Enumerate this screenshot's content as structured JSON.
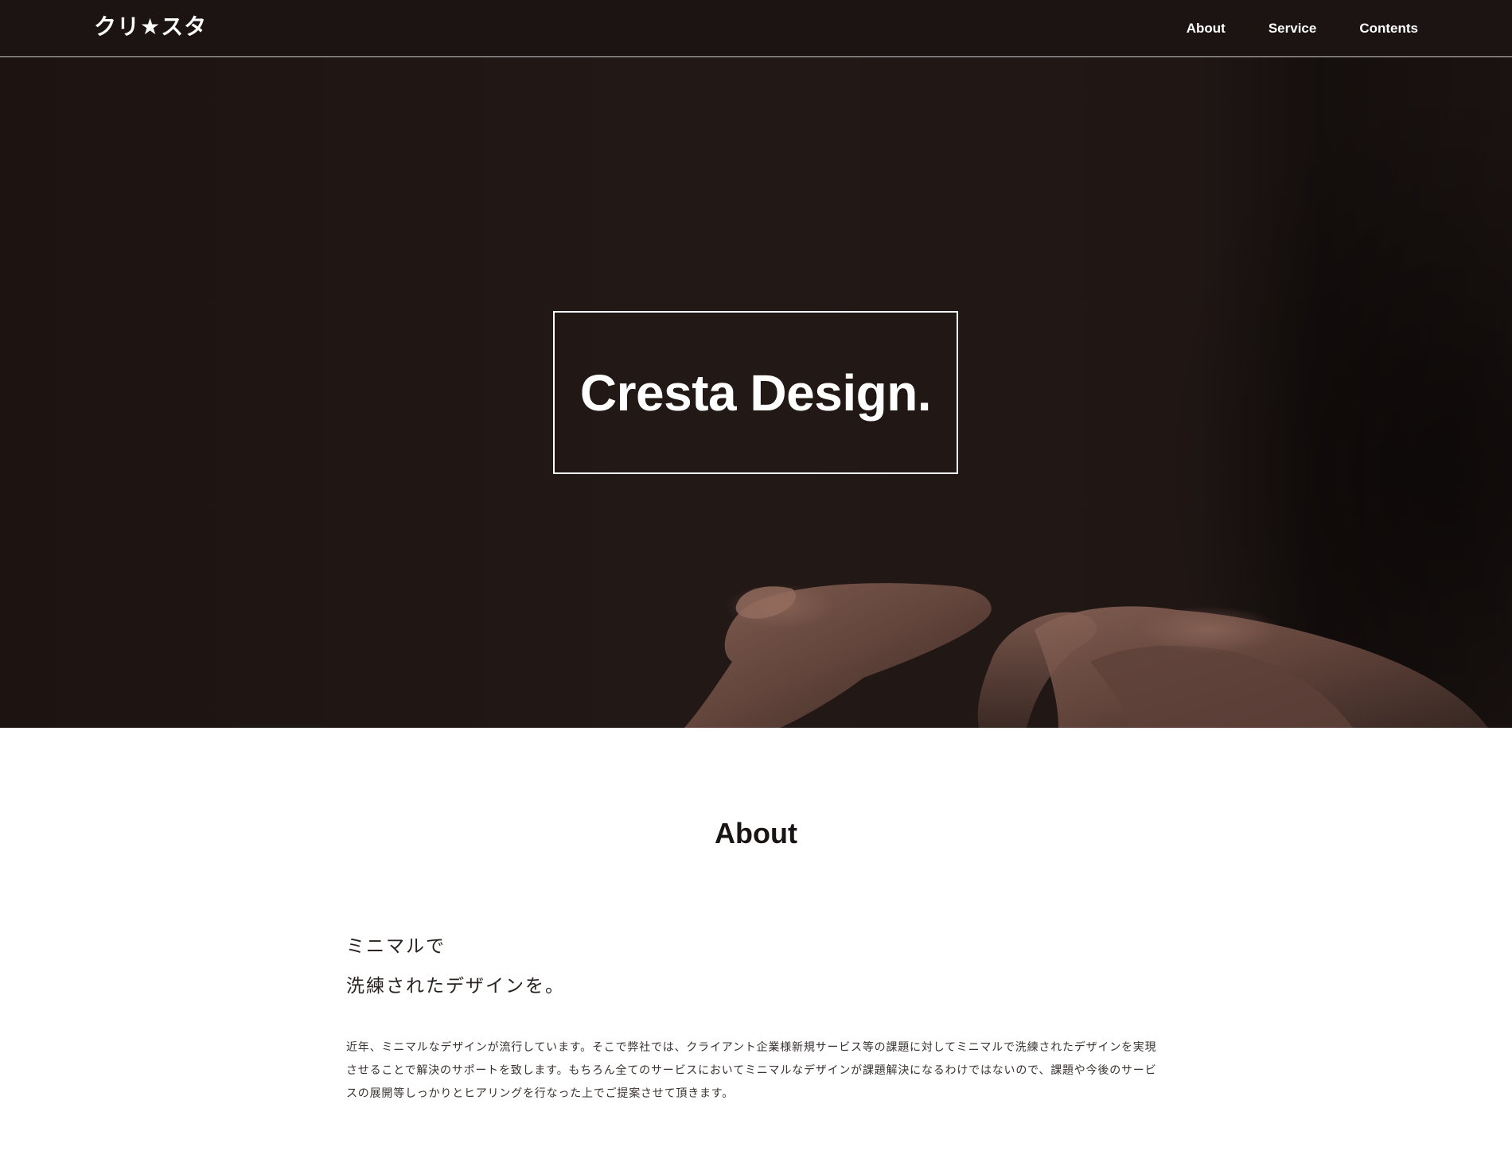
{
  "header": {
    "logo": "クリ★スタ",
    "nav": [
      {
        "label": "About"
      },
      {
        "label": "Service"
      },
      {
        "label": "Contents"
      }
    ]
  },
  "hero": {
    "title": "Cresta Design."
  },
  "about": {
    "heading": "About",
    "lead_line1": "ミニマルで",
    "lead_line2": "洗練されたデザインを。",
    "body": "近年、ミニマルなデザインが流行しています。そこで弊社では、クライアント企業様新規サービス等の課題に対してミニマルで洗練されたデザインを実現させることで解決のサポートを致します。もちろん全てのサービスにおいてミニマルなデザインが課題解決になるわけではないので、課題や今後のサービスの展開等しっかりとヒアリングを行なった上でご提案させて頂きます。"
  },
  "colors": {
    "header_bg": "#1c1413",
    "hero_bg": "#1e1513",
    "text_dark": "#1a1412"
  }
}
